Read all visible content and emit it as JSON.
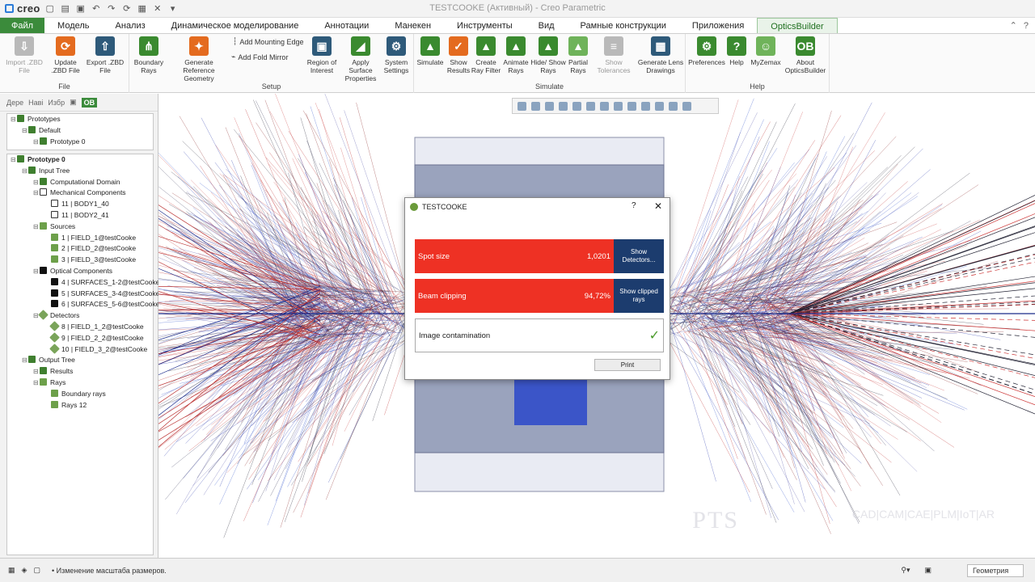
{
  "window": {
    "title": "TESTCOOKE (Активный) - Creo Parametric",
    "logo": "creo"
  },
  "tabs": [
    "Файл",
    "Модель",
    "Анализ",
    "Динамическое моделирование",
    "Аннотации",
    "Манекен",
    "Инструменты",
    "Вид",
    "Рамные конструкции",
    "Приложения",
    "OpticsBuilder"
  ],
  "ribbon": {
    "file": {
      "label": "File",
      "buttons": [
        {
          "label": "Import .ZBD File",
          "icon": "import-icon"
        },
        {
          "label": "Update .ZBD File",
          "icon": "update-icon"
        },
        {
          "label": "Export .ZBD File",
          "icon": "export-icon"
        }
      ]
    },
    "setup": {
      "label": "Setup",
      "buttons": [
        {
          "label": "Boundary Rays",
          "icon": "boundary-rays-icon"
        },
        {
          "label": "Generate Reference Geometry",
          "icon": "reference-geometry-icon"
        },
        {
          "label": "Region of Interest",
          "icon": "region-icon"
        },
        {
          "label": "Apply Surface Properties",
          "icon": "surface-icon"
        },
        {
          "label": "System Settings",
          "icon": "gear-icon"
        }
      ],
      "small": [
        "Add Mounting Edge",
        "Add Fold Mirror"
      ]
    },
    "simulate": {
      "label": "Simulate",
      "buttons": [
        {
          "label": "Simulate",
          "icon": "simulate-icon"
        },
        {
          "label": "Show Results",
          "icon": "results-icon"
        },
        {
          "label": "Create Ray Filter",
          "icon": "filter-icon"
        },
        {
          "label": "Animate Rays",
          "icon": "animate-icon"
        },
        {
          "label": "Hide/ Show Rays",
          "icon": "hide-show-icon"
        },
        {
          "label": "Partial Rays",
          "icon": "partial-rays-icon"
        },
        {
          "label": "Show Tolerances",
          "icon": "tolerances-icon"
        },
        {
          "label": "Generate Lens Drawings",
          "icon": "lens-drawings-icon"
        }
      ]
    },
    "help": {
      "label": "Help",
      "buttons": [
        {
          "label": "Preferences",
          "icon": "preferences-icon"
        },
        {
          "label": "Help",
          "icon": "help-icon"
        },
        {
          "label": "MyZemax",
          "icon": "myzemax-icon"
        },
        {
          "label": "About OpticsBuilder",
          "icon": "about-icon"
        }
      ]
    }
  },
  "left_tabs": [
    "Дере",
    "Наві",
    "Избр",
    "OB"
  ],
  "prototypes": [
    {
      "label": "Prototypes",
      "icon": "fold",
      "indent": 0
    },
    {
      "label": "Default",
      "icon": "fold",
      "indent": 1
    },
    {
      "label": "Prototype 0",
      "icon": "fold",
      "indent": 2
    }
  ],
  "tree": [
    {
      "label": "Prototype 0",
      "icon": "fold",
      "indent": 0
    },
    {
      "label": "Input Tree",
      "icon": "fold",
      "indent": 1
    },
    {
      "label": "Computational Domain",
      "icon": "fold",
      "indent": 2
    },
    {
      "label": "Mechanical Components",
      "icon": "ring",
      "indent": 2
    },
    {
      "label": "11 | BODY1_40",
      "icon": "ring",
      "indent": 3
    },
    {
      "label": "11 | BODY2_41",
      "icon": "ring",
      "indent": 3
    },
    {
      "label": "Sources",
      "icon": "sun",
      "indent": 2
    },
    {
      "label": "1 | FIELD_1@testCooke",
      "icon": "sun",
      "indent": 3
    },
    {
      "label": "2 | FIELD_2@testCooke",
      "icon": "sun",
      "indent": 3
    },
    {
      "label": "3 | FIELD_3@testCooke",
      "icon": "sun",
      "indent": 3
    },
    {
      "label": "Optical Components",
      "icon": "ball",
      "indent": 2
    },
    {
      "label": "4 | SURFACES_1-2@testCooke",
      "icon": "ball",
      "indent": 3
    },
    {
      "label": "5 | SURFACES_3-4@testCooke",
      "icon": "ball",
      "indent": 3
    },
    {
      "label": "6 | SURFACES_5-6@testCooke",
      "icon": "ball",
      "indent": 3
    },
    {
      "label": "Detectors",
      "icon": "dia",
      "indent": 2
    },
    {
      "label": "8 | FIELD_1_2@testCooke",
      "icon": "dia",
      "indent": 3
    },
    {
      "label": "9 | FIELD_2_2@testCooke",
      "icon": "dia",
      "indent": 3
    },
    {
      "label": "10 | FIELD_3_2@testCooke",
      "icon": "dia",
      "indent": 3
    },
    {
      "label": "Output Tree",
      "icon": "fold",
      "indent": 1
    },
    {
      "label": "Results",
      "icon": "fold",
      "indent": 2
    },
    {
      "label": "Rays",
      "icon": "sun",
      "indent": 2
    },
    {
      "label": "Boundary rays",
      "icon": "sun",
      "indent": 3
    },
    {
      "label": "Rays 12",
      "icon": "sun",
      "indent": 3
    }
  ],
  "dialog": {
    "title": "TESTCOOKE",
    "rows": [
      {
        "label": "Spot size",
        "value": "1,0201",
        "button": "Show Detectors..."
      },
      {
        "label": "Beam clipping",
        "value": "94,72%",
        "button": "Show clipped rays"
      }
    ],
    "ok_row": "Image contamination",
    "print": "Print"
  },
  "status": {
    "message": "• Изменение масштаба размеров.",
    "filter": "Геометрия"
  },
  "watermark": {
    "brand": "PTS",
    "tag": "CAD|CAM|CAE|PLM|IoT|AR"
  },
  "colors": {
    "file_tab": "#3b8b3b",
    "red": "#ee3124",
    "navy": "#1c3c6e"
  }
}
